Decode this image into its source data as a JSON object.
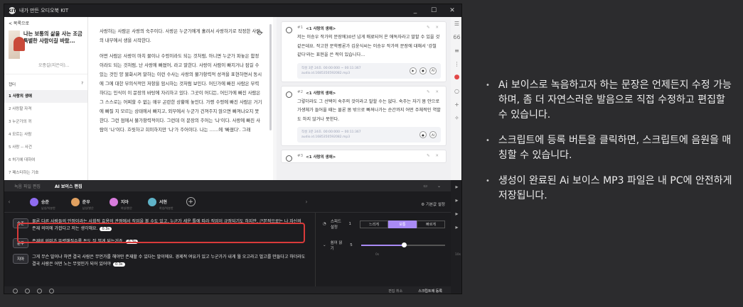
{
  "window": {
    "title": "내가 만든 오디오북 KIT",
    "logo_text": "KIT",
    "min": "_",
    "max": "☐",
    "close": "✕"
  },
  "sidebar": {
    "back": "< 목록으로",
    "book_title": "나는 보통의 삶을 사는 조금 특별한 사람이길 바랐...",
    "author": "오종길(지은이)...",
    "toc_label": "챕터",
    "help_icon": "?",
    "items": [
      {
        "label": "1 사랑의 생애",
        "active": true
      },
      {
        "label": "2 사랑할 자격",
        "active": false
      },
      {
        "label": "3 누군가의 귀",
        "active": false
      },
      {
        "label": "4 모르는 사람",
        "active": false
      },
      {
        "label": "5 사랑 -- 사건",
        "active": false
      },
      {
        "label": "6 허기에 대하여",
        "active": false
      },
      {
        "label": "7 패스타하는 기호",
        "active": false
      }
    ]
  },
  "document": {
    "paragraphs": [
      "사랑하는 사람은 사랑의 숙주이다. 사랑은 누군가에게 홀려서 사랑하기로 작정한 사람의 내부에서 생을 시작한다.",
      "어떤 사람은 사랑이 마치 물이나 수렁이라도 되는 것처럼, 아니면 누군가 파놓은 함정이라도 되는 것처럼, 난 사랑에 빠졌어, 라고 말한다. 사랑이 사람이 빠지거나 잠길 수 있는 것인 양 물화시켜 말하는 이런 수사는 사랑의 불가항력적 성격을 표현하면서 동시에 그에 대한 무의식적인 저항을 암시하는 것처럼 보인다. 어딘가에 빠진 사람은 무력하다는 인식이 이 문장의 바탕에 자리하고 있다. 그곳이 어디든, 어딘가에 빠진 사람은 그 스스로는 어찌할 수 없는 매우 곤란한 상황에 놓인다. 가령 수렁에 빠진 사람은 거기에 빠질 지 모르는 상태에서 빠지고, 외부에서 누군가 건져주지 않으면 빠져나오지 못한다. 그런 점에서 불가항력적이다. 그런데 이 문장의 주어는 '나'이다. 사랑에 빠진 사람이 '나'이다. 흐릿하고 희미하지만 '나'가 주어이다. 나는 ……에 '빠졌다'. 그래"
    ]
  },
  "cards": [
    {
      "num": "#1",
      "title": "<1 사랑의 생애>",
      "body": "저는 이승우 작가의 문장에30년 넘게 매료되어 온 애독자라고 말할 수 있을 것 같은데요. 작고한 문학평론가 김윤식씨는 이승우 작가의 문장에 대해서 '강철 같다'라는 표현을 쓴 적이 있습니다...",
      "meta1": "작성 3분 24초. 00:00:000 ~ 00:11:367",
      "meta2": "audio.id.1685350592082.mp3",
      "btn": "AI"
    },
    {
      "num": "#2",
      "title": "<1 사랑의 생애>",
      "body": "그렇더라도 그 선택이 숙주의 것이라고 말할 수는 없다. 숙주는 자기 몸 안으로 가생체가 들어올 때는 물론 몸 밖으로 빠져나가는 순간까지 어떤 주체적인 역할도 하지 않거나 못한다.",
      "meta1": "작성 3분 24초. 00:00:000 ~ 00:11:367",
      "meta2": "audio.id.1685350592082.mp3",
      "btn": "AI"
    },
    {
      "num": "#3",
      "title": "<1 사랑의 생애>",
      "body": "",
      "meta1": "",
      "meta2": "",
      "btn": ""
    }
  ],
  "panel": {
    "tab_inactive": "녹음 파일 편집",
    "tab_active": "AI 보이스 편집",
    "speakers": [
      {
        "name": "승준",
        "sub": "남성/차분한",
        "color": "#8f6cf0"
      },
      {
        "name": "준우",
        "sub": "남성/밝은",
        "color": "#e0a060"
      },
      {
        "name": "지아",
        "sub": "여성/밝은",
        "color": "#d77bdc"
      },
      {
        "name": "서현",
        "sub": "여성/차분한",
        "color": "#5fb3c8"
      }
    ],
    "add_symbol": "+",
    "config": "기본값 설정",
    "lines": [
      {
        "speaker": "승준",
        "text": "물론 다른 사람들의 인정이라는 사회적 효용의 관점에서 직업을 볼 수도 있고, 누군가 세운 틀에 따라 직업이 규정되기도 하지만, 근본적으로는 나 자신의 존재 의미에 가깝다고 저는 생각해요.",
        "dur": "0.3s"
      },
      {
        "speaker": "준우",
        "text": "존재의 의미가 뚜렷해질수록 돈도 잘 벌게 되는거죠.",
        "dur": "0.3s"
      },
      {
        "speaker": "지아",
        "text": "그게 무슨 말이냐 하면 결국 사람은 무언가를 해야만 존재할 수 있다는 말이에요. 경제적 여유가 있고 누군가가 내게 월 오고라고 벌고를 만들다고 하더라도 결국 사람은 어떤 노는 무엇인가 되어 있어야",
        "dur": "0.3s"
      }
    ],
    "speed_label": "스피드 설정",
    "speed_value": "1",
    "speed_options": [
      "느리게",
      "보통",
      "빠르게"
    ],
    "speed_selected": 1,
    "pause_label": "쉼어 읽기",
    "pause_value": "5",
    "pause_fraction": 0.5,
    "pause_min": "0s",
    "pause_max": "10s",
    "cancel": "편집 취소",
    "register": "스크립트에 등록"
  },
  "bullets": [
    "Ai 보이스로 녹음하고자 하는 문장은 언제든지 수정 가능하며, 좀 더 자연스러운 발음으로 직접 수정하고 편집할 수 있습니다.",
    "스크립트에 등록 버튼을 클릭하면, 스크립트에 음원을 매칭할 수 있습니다.",
    "생성이 완료된 Ai 보이스 MP3 파일은 내 PC에 안전하게 저장됩니다."
  ]
}
